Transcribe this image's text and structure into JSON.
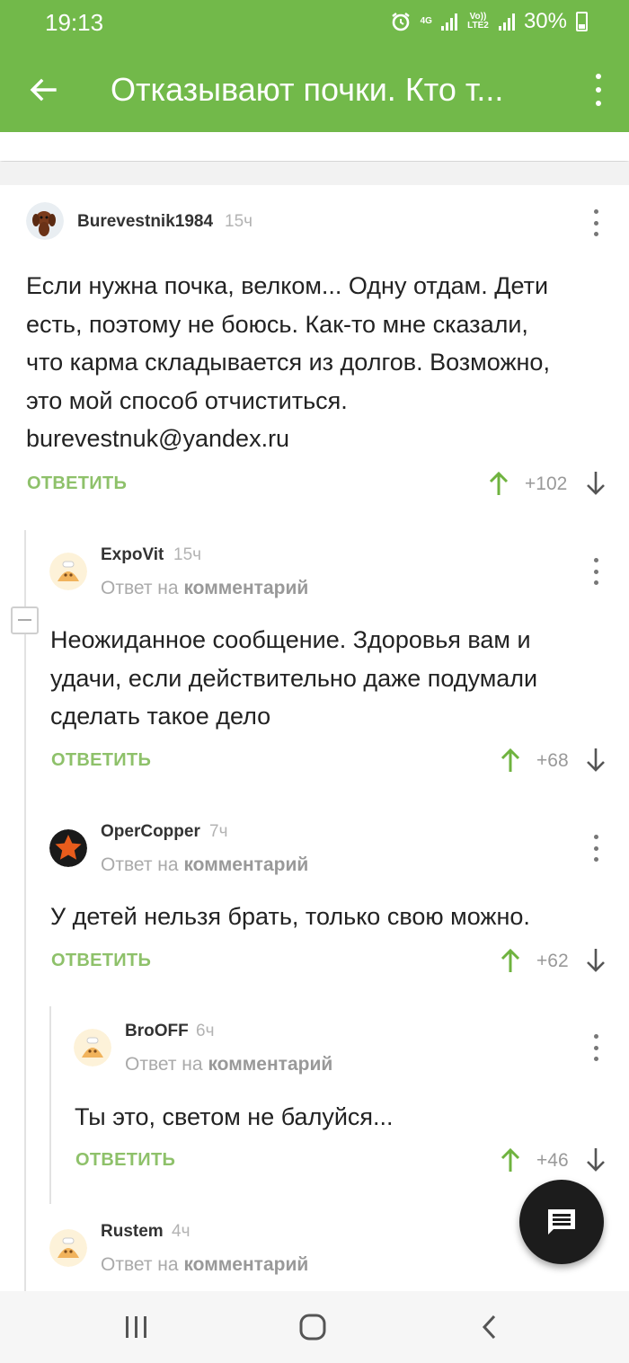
{
  "status_bar": {
    "time": "19:13",
    "net_top": "4G",
    "net_lte": "Vo)) LTE2",
    "battery": "30%"
  },
  "header": {
    "title": "Отказывают почки. Кто т..."
  },
  "colors": {
    "brand_green": "#72b94a",
    "action_green": "#8ec16a",
    "fab": "#1c1c1c"
  },
  "comments": [
    {
      "author": "Burevestnik1984",
      "age": "15ч",
      "avatar": "dog-avatar",
      "text_lines": [
        "Если нужна почка, велком... Одну отдам. Дети",
        "есть, поэтому не боюсь. Как-то мне сказали,",
        "что карма складывается из долгов. Возможно,",
        "это мой способ отчиститься.",
        "burevestnuk@yandex.ru"
      ],
      "reply_label": "ОТВЕТИТЬ",
      "score": "+102"
    },
    {
      "author": "ExpoVit",
      "age": "15ч",
      "avatar": "default-avatar",
      "reply_prefix": "Ответ на",
      "reply_target": "комментарий",
      "text_lines": [
        "Неожиданное сообщение. Здоровья вам и",
        "удачи,  если действительно даже подумали",
        "сделать такое дело"
      ],
      "reply_label": "ОТВЕТИТЬ",
      "score": "+68"
    },
    {
      "author": "OperCopper",
      "age": "7ч",
      "avatar": "star-avatar",
      "reply_prefix": "Ответ на",
      "reply_target": "комментарий",
      "text_lines": [
        "У детей нельзя брать, только свою можно."
      ],
      "reply_label": "ОТВЕТИТЬ",
      "score": "+62"
    },
    {
      "author": "BroOFF",
      "age": "6ч",
      "avatar": "default-avatar",
      "reply_prefix": "Ответ на",
      "reply_target": "комментарий",
      "text_lines": [
        "Ты это, светом не балуйся..."
      ],
      "reply_label": "ОТВЕТИТЬ",
      "score": "+46"
    },
    {
      "author": "Rustem",
      "age": "4ч",
      "avatar": "default-avatar",
      "reply_prefix": "Ответ на",
      "reply_target": "комментарий"
    }
  ],
  "fab": {
    "icon": "comment-icon"
  },
  "nav": {
    "recents_icon": "recents-icon",
    "home_icon": "home-icon",
    "back_icon": "back-icon"
  }
}
